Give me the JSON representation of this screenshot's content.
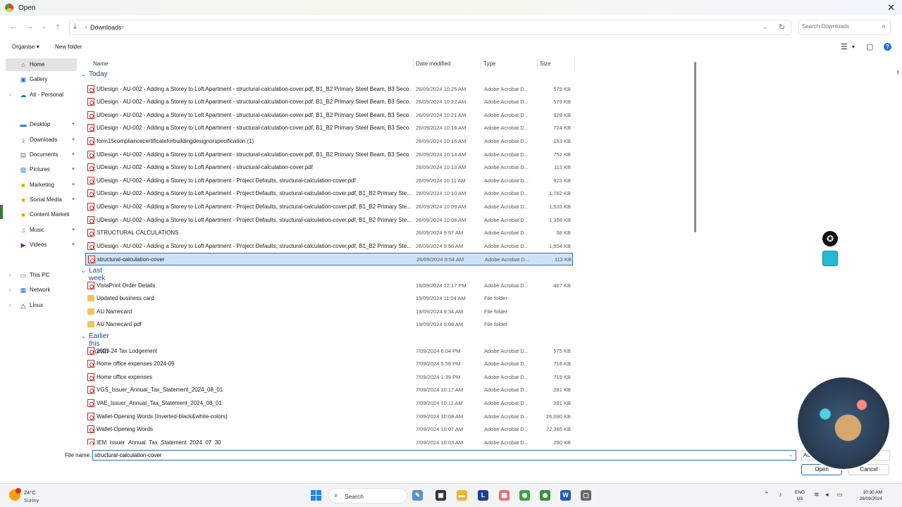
{
  "window": {
    "title": "Open"
  },
  "address": {
    "location": "Downloads"
  },
  "search": {
    "placeholder": "Search Downloads"
  },
  "toolbar": {
    "organise": "Organise ▾",
    "new_folder": "New folder"
  },
  "sidebar": {
    "items": [
      {
        "label": "Home",
        "icon": "home-icon"
      },
      {
        "label": "Gallery",
        "icon": "gallery-icon"
      },
      {
        "label": "Ati - Personal",
        "icon": "cloud-icon"
      },
      {
        "label": "Desktop",
        "icon": "desktop-icon"
      },
      {
        "label": "Downloads",
        "icon": "download-icon"
      },
      {
        "label": "Documents",
        "icon": "documents-icon"
      },
      {
        "label": "Pictures",
        "icon": "pictures-icon"
      },
      {
        "label": "Marketing",
        "icon": "folder-icon"
      },
      {
        "label": "Social Media",
        "icon": "folder-icon"
      },
      {
        "label": "Content Marketi",
        "icon": "folder-icon"
      },
      {
        "label": "Music",
        "icon": "music-icon"
      },
      {
        "label": "Videos",
        "icon": "videos-icon"
      },
      {
        "label": "This PC",
        "icon": "pc-icon"
      },
      {
        "label": "Network",
        "icon": "network-icon"
      },
      {
        "label": "Linux",
        "icon": "linux-icon"
      }
    ]
  },
  "columns": {
    "name": "Name",
    "date": "Date modified",
    "type": "Type",
    "size": "Size"
  },
  "groups": [
    {
      "label": "Today",
      "files": [
        {
          "name": "UDesign - AU-002 - Adding a Storey to Loft Apartment - structural-calculation-cover.pdf, B1_B2 Primary Steel Beam, B3 Seco...",
          "date": "26/09/2024 10:25 AM",
          "type": "Adobe Acrobat D...",
          "size": "579 KB",
          "kind": "pdf"
        },
        {
          "name": "UDesign - AU-002 - Adding a Storey to Loft Apartment - structural-calculation-cover.pdf, B1_B2 Primary Steel Beam, B3 Seco...",
          "date": "26/09/2024 10:22 AM",
          "type": "Adobe Acrobat D...",
          "size": "579 KB",
          "kind": "pdf"
        },
        {
          "name": "UDesign - AU-002 - Adding a Storey to Loft Apartment - structural-calculation-cover.pdf, B1_B2 Primary Steel Beam, B3 Seco...",
          "date": "26/09/2024 10:21 AM",
          "type": "Adobe Acrobat D...",
          "size": "928 KB",
          "kind": "pdf"
        },
        {
          "name": "UDesign - AU-002 - Adding a Storey to Loft Apartment - structural-calculation-cover.pdf, B1_B2 Primary Steel Beam, B3 Seco...",
          "date": "26/09/2024 10:18 AM",
          "type": "Adobe Acrobat D...",
          "size": "724 KB",
          "kind": "pdf"
        },
        {
          "name": "form15compliancecertificateforbuildingdesignorspecification (1)",
          "date": "26/09/2024 10:16 AM",
          "type": "Adobe Acrobat D...",
          "size": "153 KB",
          "kind": "pdf"
        },
        {
          "name": "UDesign - AU-002 - Adding a Storey to Loft Apartment - structural-calculation-cover.pdf, B1_B2 Primary Steel Beam, B3 Seco...",
          "date": "26/09/2024 10:14 AM",
          "type": "Adobe Acrobat D...",
          "size": "752 KB",
          "kind": "pdf"
        },
        {
          "name": "UDesign - AU-002 - Adding a Storey to Loft Apartment - structural-calculation-cover.pdf",
          "date": "26/09/2024 10:13 AM",
          "type": "Adobe Acrobat D...",
          "size": "113 KB",
          "kind": "pdf"
        },
        {
          "name": "UDesign - AU-002 - Adding a Storey to Loft Apartment - Project Defaults, structural-calculation-cover.pdf",
          "date": "26/09/2024 10:11 AM",
          "type": "Adobe Acrobat D...",
          "size": "923 KB",
          "kind": "pdf"
        },
        {
          "name": "UDesign - AU-002 - Adding a Storey to Loft Apartment - Project Defaults, structural-calculation-cover.pdf, B1_B2 Primary Ste...",
          "date": "26/09/2024 10:10 AM",
          "type": "Adobe Acrobat D...",
          "size": "1,762 KB",
          "kind": "pdf"
        },
        {
          "name": "UDesign - AU-002 - Adding a Storey to Loft Apartment - Project Defaults, structural-calculation-cover.pdf, B1_B2 Primary Ste...",
          "date": "26/09/2024 10:09 AM",
          "type": "Adobe Acrobat D...",
          "size": "1,533 KB",
          "kind": "pdf"
        },
        {
          "name": "UDesign - AU-002 - Adding a Storey to Loft Apartment - Project Defaults, structural-calculation-cover.pdf, B1_B2 Primary Ste...",
          "date": "26/09/2024 10:08 AM",
          "type": "Adobe Acrobat D...",
          "size": "1,358 KB",
          "kind": "pdf"
        },
        {
          "name": "STRUCTURAL CALCULATIONS",
          "date": "26/09/2024 9:57 AM",
          "type": "Adobe Acrobat D...",
          "size": "58 KB",
          "kind": "pdf"
        },
        {
          "name": "UDesign - AU-002 - Adding a Storey to Loft Apartment - Project Defaults, structural-calculation-cover.pdf, B1_B2 Primary Ste...",
          "date": "26/09/2024 9:56 AM",
          "type": "Adobe Acrobat D...",
          "size": "1,554 KB",
          "kind": "pdf"
        },
        {
          "name": "structural-calculation-cover",
          "date": "26/09/2024 9:54 AM",
          "type": "Adobe Acrobat D...",
          "size": "113 KB",
          "kind": "pdf",
          "selected": true
        }
      ]
    },
    {
      "label": "Last week",
      "files": [
        {
          "name": "VistaPrint Order Details",
          "date": "19/09/2024 12:17 PM",
          "type": "Adobe Acrobat D...",
          "size": "467 KB",
          "kind": "pdf"
        },
        {
          "name": "Updated business card",
          "date": "19/09/2024 11:04 AM",
          "type": "File folder",
          "size": "",
          "kind": "folder"
        },
        {
          "name": "AU Namecard",
          "date": "19/09/2024 9:34 AM",
          "type": "File folder",
          "size": "",
          "kind": "folder"
        },
        {
          "name": "AU Namecard pdf",
          "date": "19/09/2024 6:08 AM",
          "type": "File folder",
          "size": "",
          "kind": "folder"
        }
      ]
    },
    {
      "label": "Earlier this month",
      "files": [
        {
          "name": "2023-24 Tax Lodgement",
          "date": "7/09/2024 6:04 PM",
          "type": "Adobe Acrobat D...",
          "size": "575 KB",
          "kind": "pdf"
        },
        {
          "name": "Home office expenses 2024-09",
          "date": "7/09/2024 5:59 PM",
          "type": "Adobe Acrobat D...",
          "size": "718 KB",
          "kind": "pdf"
        },
        {
          "name": "Home office expenses",
          "date": "7/09/2024 1:39 PM",
          "type": "Adobe Acrobat D...",
          "size": "719 KB",
          "kind": "pdf"
        },
        {
          "name": "VGS_Issuer_Annual_Tax_Statement_2024_08_01",
          "date": "7/09/2024 10:17 AM",
          "type": "Adobe Acrobat D...",
          "size": "281 KB",
          "kind": "pdf"
        },
        {
          "name": "VAE_Issuer_Annual_Tax_Statement_2024_08_01",
          "date": "7/09/2024 10:11 AM",
          "type": "Adobe Acrobat D...",
          "size": "281 KB",
          "kind": "pdf"
        },
        {
          "name": "Wallet-Opening Words (Inverted-black&white-colors)",
          "date": "7/09/2024 10:08 AM",
          "type": "Adobe Acrobat D...",
          "size": "26,090 KB",
          "kind": "pdf"
        },
        {
          "name": "Wallet-Opening Words",
          "date": "7/09/2024 10:07 AM",
          "type": "Adobe Acrobat D...",
          "size": "72,365 KB",
          "kind": "pdf"
        },
        {
          "name": "IEM_Issuer_Annual_Tax_Statement_2024_07_30",
          "date": "7/09/2024 10:03 AM",
          "type": "Adobe Acrobat D...",
          "size": "290 KB",
          "kind": "pdf"
        }
      ]
    }
  ],
  "footer": {
    "file_name_label": "File name:",
    "file_name_value": "structural-calculation-cover",
    "filter_value": "Au",
    "open_label": "Open",
    "cancel_label": "Cancel"
  },
  "taskbar": {
    "temperature": "24°C",
    "condition": "Sunny",
    "search_label": "Search",
    "lang_1": "ENG",
    "lang_2": "US",
    "time": "10:30 AM",
    "date": "26/09/2024"
  },
  "colors": {
    "accent": "#2b6cc2",
    "selection": "#cde3fb",
    "pdf_red": "#c62828",
    "folder": "#f4c45a"
  }
}
